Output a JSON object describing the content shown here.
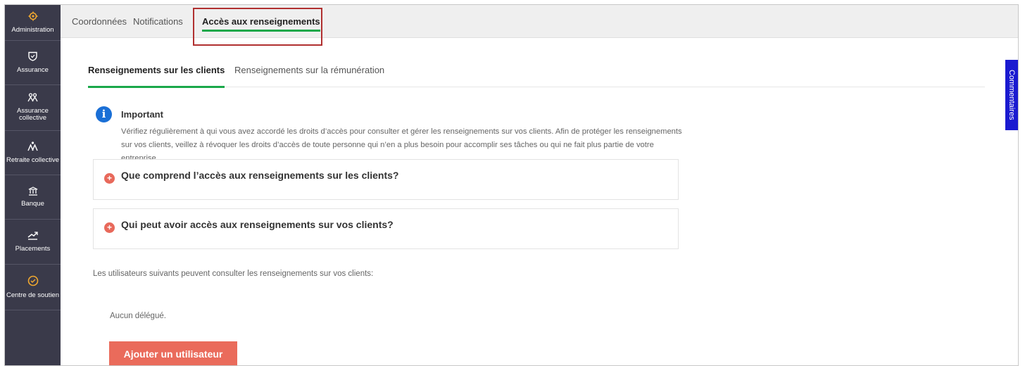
{
  "sidebar": {
    "items": [
      {
        "label": "Administration",
        "icon": "gear-icon"
      },
      {
        "label": "Assurance",
        "icon": "shield-icon"
      },
      {
        "label": "Assurance collective",
        "icon": "group-icon"
      },
      {
        "label": "Retraite collective",
        "icon": "people-icon"
      },
      {
        "label": "Banque",
        "icon": "bank-icon"
      },
      {
        "label": "Placements",
        "icon": "chart-up-icon"
      },
      {
        "label": "Centre de soutien",
        "icon": "check-circle-icon"
      }
    ],
    "accent_color": "#f0a830"
  },
  "top_tabs": [
    "Coordonnées",
    "Notifications",
    "Accès aux renseignements"
  ],
  "top_tabs_active": "Accès aux renseignements",
  "feedback_tab": "Commentaires",
  "sub_tabs": [
    "Renseignements sur les clients",
    "Renseignements sur la rémunération"
  ],
  "sub_tabs_active": "Renseignements sur les clients",
  "notice": {
    "icon": "info-icon",
    "title": "Important",
    "text": "Vérifiez régulièrement à qui vous avez accordé les droits d’accès pour consulter et gérer les renseignements sur vos clients. Afin de protéger les renseignements sur vos clients, veillez à révoquer les droits d’accès de toute personne qui n’en a plus besoin pour accomplir ses tâches ou qui ne fait plus partie de votre entreprise."
  },
  "accordions": [
    "Que comprend l’accès aux renseignements sur les clients?",
    "Qui peut avoir accès aux renseignements sur vos clients?"
  ],
  "users_text": "Les utilisateurs suivants peuvent consulter les renseignements sur vos clients:",
  "no_delegate": "Aucun délégué.",
  "add_user_button": "Ajouter un utilisateur",
  "colors": {
    "sidebar_bg": "#3a3a4a",
    "active_underline": "#1aa84a",
    "highlight_border": "#b03030",
    "button_bg": "#ea6b5b",
    "info_blue": "#1a6fd6",
    "feedback_blue": "#1a1ad0"
  }
}
